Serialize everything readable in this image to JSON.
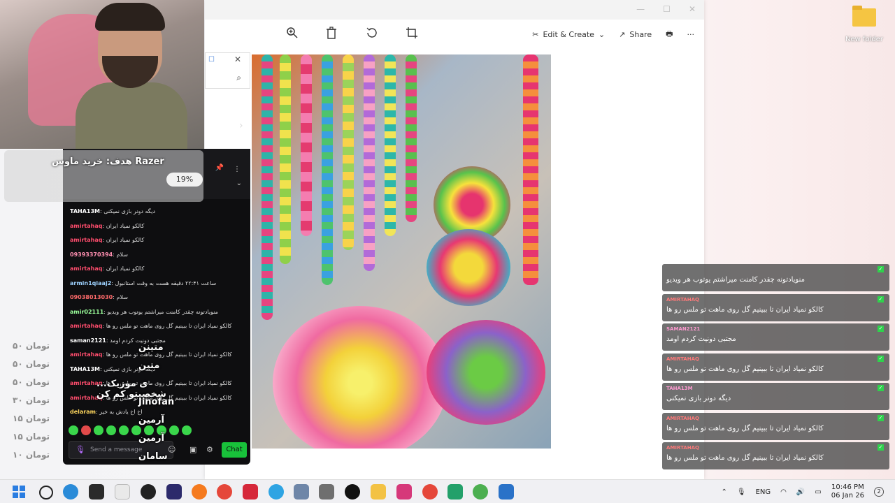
{
  "desktop": {
    "folder_label": "New folder"
  },
  "photos": {
    "toolbar": {
      "edit_create": "Edit & Create",
      "share": "Share",
      "more": "···"
    },
    "window_controls": [
      "—",
      "☐",
      "✕"
    ]
  },
  "goal": {
    "title": "هدف: خرید ماوس Razer",
    "percent": "19%"
  },
  "chat": {
    "messages": [
      {
        "user": "TAHA13M",
        "text": "دیگه دونر بازی نمیکنی",
        "color": "#ffffff"
      },
      {
        "user": "amirtahaq",
        "text": "کالکو نمیاد ایران",
        "color": "#ff4d6d"
      },
      {
        "user": "amirtahaq",
        "text": "کالکو نمیاد ایران",
        "color": "#ff4d6d"
      },
      {
        "user": "09393370394",
        "text": "سلام",
        "color": "#ff8fb0"
      },
      {
        "user": "amirtahaq",
        "text": "کالکو نمیاد ایران",
        "color": "#ff4d6d"
      },
      {
        "user": "armin1qiaaj2",
        "text": "ساعت ۲۲:۴۱ دقیقه هست به وقت استانبول",
        "color": "#9ed2ff"
      },
      {
        "user": "09038013030",
        "text": "سلام",
        "color": "#ff6b6b"
      },
      {
        "user": "amir02111",
        "text": "منویادتونه چقدر کامنت میراشتم یوتوب هر ویدیو",
        "color": "#9bff9b"
      },
      {
        "user": "amirtahaq",
        "text": "کالکو نمیاد ایران تا ببینیم گل روی ماهت تو ملس رو ها",
        "color": "#ff4d6d"
      },
      {
        "user": "saman2121",
        "text": "مجتبی دونیت کردم اومد",
        "color": "#ffffff"
      },
      {
        "user": "amirtahaq",
        "text": "کالکو نمیاد ایران تا ببینیم گل روی ماهت تو ملس رو ها",
        "color": "#ff4d6d"
      },
      {
        "user": "TAHA13M",
        "text": "دیگه دونر بازی نمیکنی",
        "color": "#ffffff"
      },
      {
        "user": "amirtahaq",
        "text": "کالکو نمیاد ایران تا ببینیم گل روی ماهت تو ملس رو ها",
        "color": "#ff4d6d"
      },
      {
        "user": "amirtahaq",
        "text": "کالکو نمیاد ایران تا ببینیم گل روی ماهت تو ملس رو ها",
        "color": "#ff4d6d"
      },
      {
        "user": "delaram",
        "text": "اخ اخ یادش به خیر",
        "color": "#ffd75e"
      }
    ],
    "input_placeholder": "Send a message",
    "chat_button": "Chat"
  },
  "donors": [
    {
      "name": "متینن",
      "amount": "۵۰ تومان"
    },
    {
      "name": "متین",
      "amount": "۵۰ تومان"
    },
    {
      "name": "...ی موزیک شخصیتو کم کن",
      "amount": "۵۰ تومان"
    },
    {
      "name": "Jinofan",
      "amount": "۳۰ تومان"
    },
    {
      "name": "آرمین",
      "amount": "۱۵ تومان"
    },
    {
      "name": "آرمین",
      "amount": "۱۵ تومان"
    },
    {
      "name": "سامان",
      "amount": "۱۰ تومان"
    }
  ],
  "right_chat": [
    {
      "user": "",
      "text": "منویادتونه چقدر کامنت میراشتم یوتوب هر ویدیو",
      "ucolor": "#5dd65d"
    },
    {
      "user": "AMIRTAHAQ",
      "text": "کالکو نمیاد ایران تا ببینیم گل روی ماهت تو ملس رو ها",
      "ucolor": "#ff7a7a"
    },
    {
      "user": "SAMAN2121",
      "text": "مجتبی دونیت کردم اومد",
      "ucolor": "#ff9ad1"
    },
    {
      "user": "AMIRTAHAQ",
      "text": "کالکو نمیاد ایران تا ببینیم گل روی ماهت تو ملس رو ها",
      "ucolor": "#ff7a7a"
    },
    {
      "user": "TAHA13M",
      "text": "دیگه دونر بازی نمیکنی",
      "ucolor": "#ff9ad1"
    },
    {
      "user": "AMIRTAHAQ",
      "text": "کالکو نمیاد ایران تا ببینیم گل روی ماهت تو ملس رو ها",
      "ucolor": "#ff7a7a"
    },
    {
      "user": "AMIRTAHAQ",
      "text": "کالکو نمیاد ایران تا ببینیم گل روی ماهت تو ملس رو ها",
      "ucolor": "#ff7a7a"
    }
  ],
  "taskbar": {
    "lang": "ENG",
    "time": "10:46 PM",
    "date": "06 Jan 26",
    "notifications": "2"
  }
}
